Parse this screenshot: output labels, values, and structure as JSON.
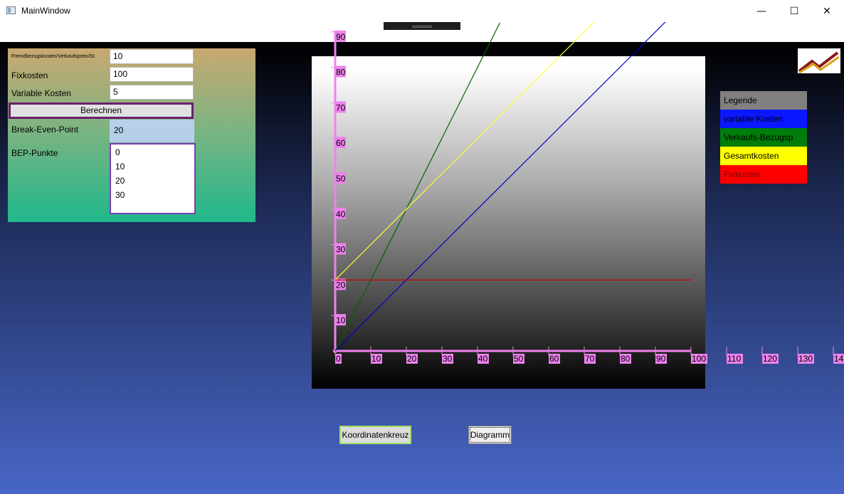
{
  "window": {
    "title": "MainWindow",
    "minimize_glyph": "—",
    "maximize_glyph": "☐",
    "close_glyph": "✕"
  },
  "form": {
    "fremdbezug_label": "Fremdbezugskosten/Verkaufspreis/St.",
    "fremdbezug_value": "10",
    "fixkosten_label": "Fixkosten",
    "fixkosten_value": "100",
    "variable_label": "Variable Kosten",
    "variable_value": "5",
    "calc_button": "Berechnen",
    "bep_label": "Break-Even-Point",
    "bep_value": "20",
    "bep_points_label": "BEP-Punkte",
    "bep_points": [
      "0",
      "10",
      "20",
      "30"
    ]
  },
  "legend": {
    "title": "Legende",
    "items": [
      {
        "label": "variable Kosten",
        "bg": "#0a17ff",
        "fg": "#000000"
      },
      {
        "label": "Verkaufs-Bezugsp",
        "bg": "#007d0a",
        "fg": "#000000"
      },
      {
        "label": "Gesamtkosten",
        "bg": "#ffff00",
        "fg": "#000000"
      },
      {
        "label": "Fixkosten",
        "bg": "#ff0000",
        "fg": "#7a0000"
      }
    ],
    "title_bg": "#808080"
  },
  "chart_data": {
    "type": "line",
    "x_ticks": [
      "0",
      "10",
      "20",
      "30",
      "40",
      "50",
      "60",
      "70",
      "80",
      "90",
      "100",
      "110",
      "120",
      "130",
      "14"
    ],
    "y_ticks": [
      "10",
      "20",
      "30",
      "40",
      "50",
      "60",
      "70",
      "80",
      "90"
    ],
    "axis_color": "#ee82ee",
    "series": [
      {
        "name": "variable Kosten",
        "color": "#0000cc",
        "x": [
          0,
          93
        ],
        "y": [
          0,
          93
        ]
      },
      {
        "name": "Verkaufs-Bezugsp",
        "color": "#006400",
        "x": [
          0,
          46.3
        ],
        "y": [
          0,
          92.6
        ]
      },
      {
        "name": "Gesamtkosten",
        "color": "#ffff33",
        "x": [
          0,
          72.6
        ],
        "y": [
          20,
          92.6
        ]
      },
      {
        "name": "Fixkosten",
        "color": "#cc0000",
        "x": [
          0,
          100
        ],
        "y": [
          20,
          20
        ]
      }
    ]
  },
  "buttons": {
    "koordinatenkreuz": "Koordinatenkreuz",
    "diagramm": "Diagramm"
  }
}
